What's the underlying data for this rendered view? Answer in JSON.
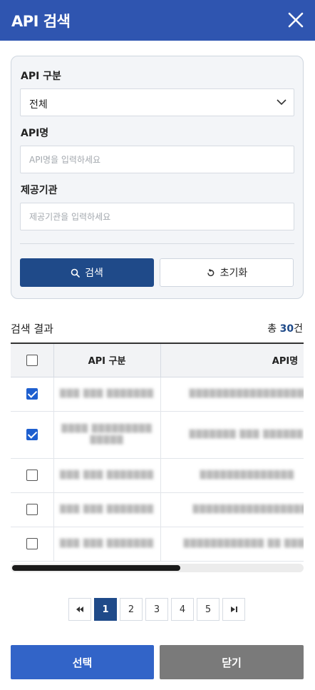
{
  "header": {
    "title": "API 검색",
    "close_icon": "close-icon"
  },
  "filters": {
    "api_type_label": "API 구분",
    "api_type_value": "전체",
    "api_name_label": "API명",
    "api_name_placeholder": "API명을 입력하세요",
    "provider_label": "제공기관",
    "provider_placeholder": "제공기관을 입력하세요",
    "search_label": "검색",
    "reset_label": "초기화"
  },
  "results": {
    "title": "검색 결과",
    "count_prefix": "총 ",
    "count": "30",
    "count_suffix": "건",
    "columns": [
      "API 구분",
      "API명"
    ],
    "rows": [
      {
        "checked": true,
        "type": "",
        "name": ""
      },
      {
        "checked": true,
        "type": "",
        "name": ""
      },
      {
        "checked": false,
        "type": "",
        "name": ""
      },
      {
        "checked": false,
        "type": "",
        "name": ""
      },
      {
        "checked": false,
        "type": "",
        "name": ""
      }
    ]
  },
  "pagination": {
    "first_icon": "double-chevron-left-icon",
    "pages": [
      "1",
      "2",
      "3",
      "4",
      "5"
    ],
    "current": "1",
    "last_icon": "skip-last-icon"
  },
  "footer": {
    "select_label": "선택",
    "close_label": "닫기"
  },
  "colors": {
    "header": "#2f55b0",
    "primary_dark": "#1f4a89",
    "primary": "#3264c8",
    "checkbox": "#1e5fcf",
    "secondary": "#7a7a7a"
  }
}
